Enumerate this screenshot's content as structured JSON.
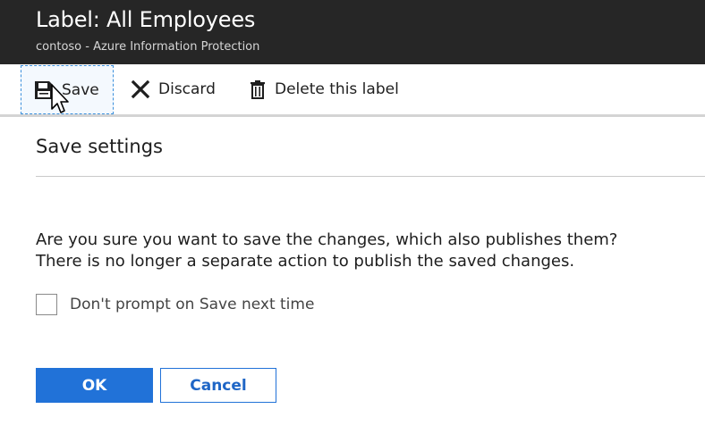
{
  "header": {
    "title": "Label: All Employees",
    "subtitle": "contoso - Azure Information Protection"
  },
  "toolbar": {
    "save_label": "Save",
    "discard_label": "Discard",
    "delete_label": "Delete this label",
    "save_icon": "floppy-disk-icon",
    "discard_icon": "close-x-icon",
    "delete_icon": "trash-icon"
  },
  "panel": {
    "title": "Save settings",
    "message_line1": "Are you sure you want to save the changes, which also publishes them?",
    "message_line2": "There is no longer a separate action to publish the saved changes.",
    "checkbox_label": "Don't prompt on Save next time",
    "checkbox_checked": false,
    "ok_label": "OK",
    "cancel_label": "Cancel"
  },
  "colors": {
    "header_bg": "#262626",
    "primary": "#2172d8",
    "focus_border": "#3a8fdc"
  }
}
